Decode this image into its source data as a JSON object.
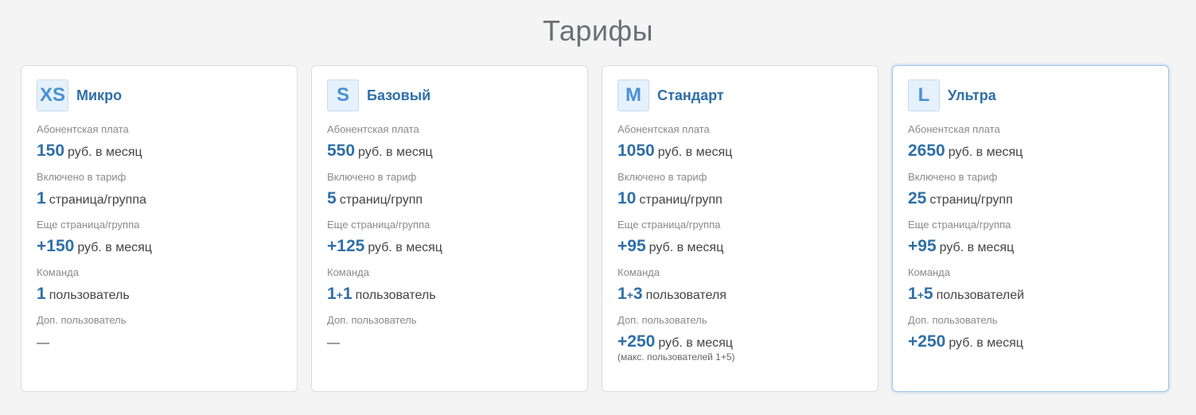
{
  "page": {
    "title": "Тарифы"
  },
  "labels": {
    "fee": "Абонентская плата",
    "included": "Включено в тариф",
    "extra_page": "Еще страница/группа",
    "team": "Команда",
    "extra_user": "Доп. пользователь"
  },
  "plans": [
    {
      "badge": "XS",
      "name": "Микро",
      "fee": {
        "num": "150",
        "unit": "руб. в месяц"
      },
      "included": {
        "num": "1",
        "unit": "страница/группа"
      },
      "extra_page": {
        "num": "+150",
        "unit": "руб. в месяц"
      },
      "team": {
        "num": "1",
        "plus": "",
        "extra": "",
        "unit": "пользователь"
      },
      "extra_user": {
        "num": "",
        "unit": "",
        "dash": "—",
        "note": ""
      }
    },
    {
      "badge": "S",
      "name": "Базовый",
      "fee": {
        "num": "550",
        "unit": "руб. в месяц"
      },
      "included": {
        "num": "5",
        "unit": "страниц/групп"
      },
      "extra_page": {
        "num": "+125",
        "unit": "руб. в месяц"
      },
      "team": {
        "num": "1",
        "plus": "+",
        "extra": "1",
        "unit": "пользователь"
      },
      "extra_user": {
        "num": "",
        "unit": "",
        "dash": "—",
        "note": ""
      }
    },
    {
      "badge": "M",
      "name": "Стандарт",
      "fee": {
        "num": "1050",
        "unit": "руб. в месяц"
      },
      "included": {
        "num": "10",
        "unit": "страниц/групп"
      },
      "extra_page": {
        "num": "+95",
        "unit": "руб. в месяц"
      },
      "team": {
        "num": "1",
        "plus": "+",
        "extra": "3",
        "unit": "пользователя"
      },
      "extra_user": {
        "num": "+250",
        "unit": "руб. в месяц",
        "dash": "",
        "note": "(макс. пользователей 1+5)"
      }
    },
    {
      "badge": "L",
      "name": "Ультра",
      "fee": {
        "num": "2650",
        "unit": "руб. в месяц"
      },
      "included": {
        "num": "25",
        "unit": "страниц/групп"
      },
      "extra_page": {
        "num": "+95",
        "unit": "руб. в месяц"
      },
      "team": {
        "num": "1",
        "plus": "+",
        "extra": "5",
        "unit": "пользователей"
      },
      "extra_user": {
        "num": "+250",
        "unit": "руб. в месяц",
        "dash": "",
        "note": ""
      }
    }
  ],
  "colors": {
    "accent": "#2f6fa8",
    "badge_bg": "#e5f1fb",
    "highlight_border": "#9cc7ec"
  }
}
